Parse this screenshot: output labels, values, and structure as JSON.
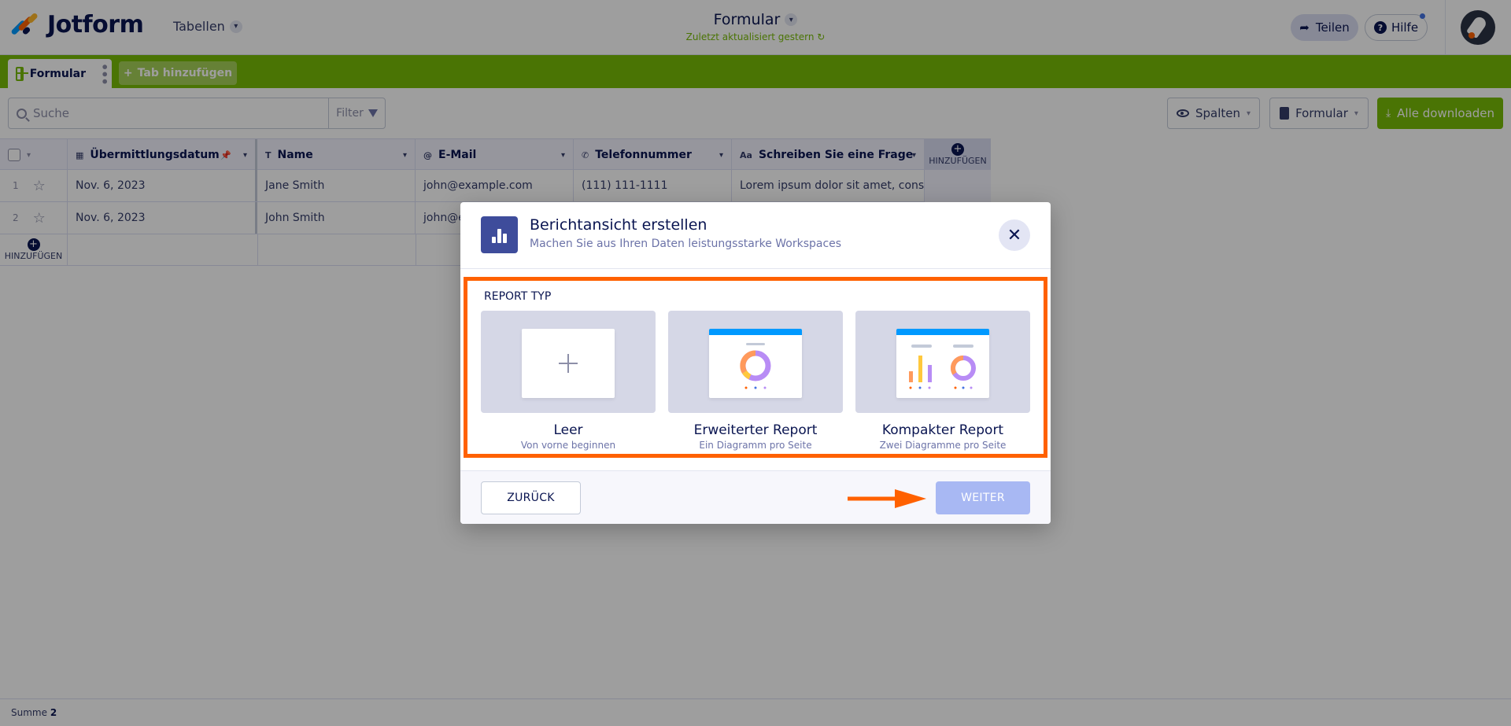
{
  "app": {
    "brand": "Jotform",
    "tables_menu": "Tabellen",
    "form_title": "Formular",
    "last_updated": "Zuletzt aktualisiert gestern",
    "share_label": "Teilen",
    "help_label": "Hilfe"
  },
  "tabs": {
    "active": "Formular",
    "add": "Tab hinzufügen"
  },
  "toolbar": {
    "search_placeholder": "Suche",
    "filter_label": "Filter",
    "columns_label": "Spalten",
    "form_label": "Formular",
    "download_label": "Alle downloaden"
  },
  "table": {
    "columns": [
      {
        "label": "Übermittlungsdatum",
        "icon": "calendar-icon"
      },
      {
        "label": "Name",
        "icon": "text-icon"
      },
      {
        "label": "E-Mail",
        "icon": "at-icon"
      },
      {
        "label": "Telefonnummer",
        "icon": "phone-icon"
      },
      {
        "label": "Schreiben Sie eine Frage",
        "icon": "aa-icon"
      }
    ],
    "add_column_label": "HINZUFÜGEN",
    "add_row_label": "HINZUFÜGEN",
    "rows": [
      {
        "num": "1",
        "date": "Nov. 6, 2023",
        "name": "Jane Smith",
        "email": "john@example.com",
        "phone": "(111) 111-1111",
        "question": "Lorem ipsum dolor sit amet, cons..."
      },
      {
        "num": "2",
        "date": "Nov. 6, 2023",
        "name": "John Smith",
        "email": "john@e",
        "phone": "",
        "question": ""
      }
    ]
  },
  "footer": {
    "sum_label": "Summe",
    "sum_value": "2"
  },
  "modal": {
    "title": "Berichtansicht erstellen",
    "subtitle": "Machen Sie aus Ihren Daten leistungsstarke Workspaces",
    "section_label": "REPORT TYP",
    "cards": [
      {
        "title": "Leer",
        "subtitle": "Von vorne beginnen"
      },
      {
        "title": "Erweiterter Report",
        "subtitle": "Ein Diagramm pro Seite"
      },
      {
        "title": "Kompakter Report",
        "subtitle": "Zwei Diagramme pro Seite"
      }
    ],
    "back_label": "ZURÜCK",
    "next_label": "WEITER"
  },
  "colors": {
    "brand_green": "#78bb07",
    "navy": "#0a1551",
    "highlight": "#ff6100",
    "next_disabled": "#a8b8f3"
  }
}
